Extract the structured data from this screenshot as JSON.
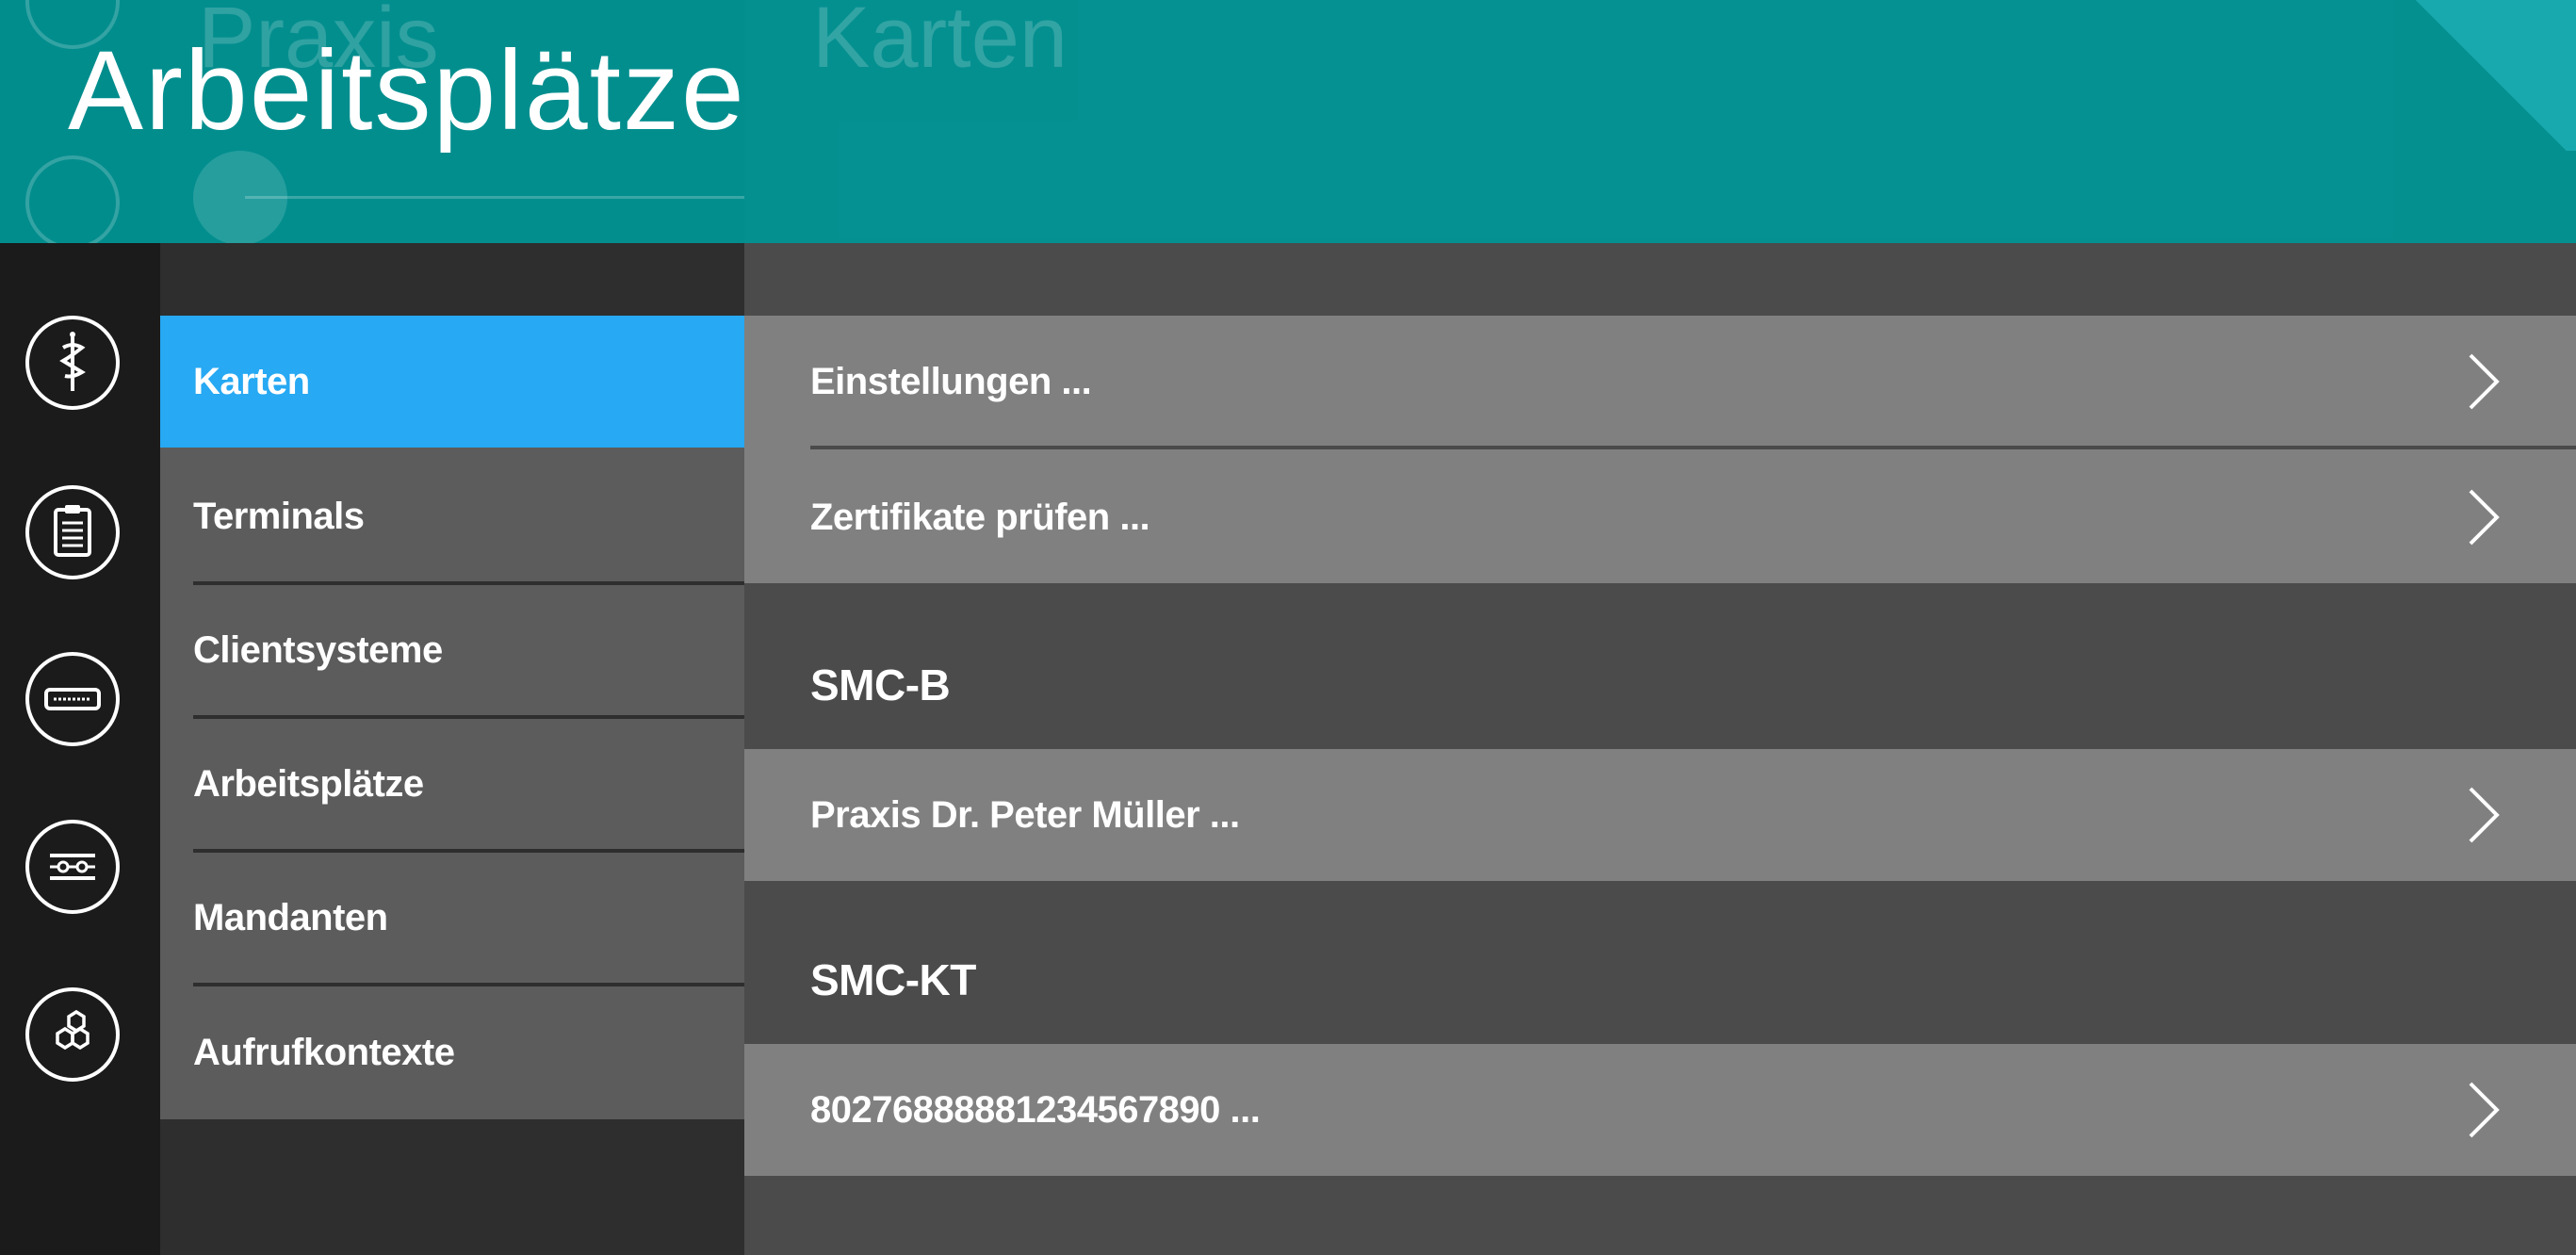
{
  "banner": {
    "title": "Arbeitsplätze",
    "ghost_left": "Praxis",
    "ghost_right": "Karten"
  },
  "rail": {
    "icons": [
      "caduceus-icon",
      "clipboard-icon",
      "terminal-device-icon",
      "settings-sliders-icon",
      "network-nodes-icon"
    ]
  },
  "subnav": {
    "items": [
      {
        "label": "Karten",
        "active": true
      },
      {
        "label": "Terminals",
        "active": false
      },
      {
        "label": "Clientsysteme",
        "active": false
      },
      {
        "label": "Arbeitsplätze",
        "active": false
      },
      {
        "label": "Mandanten",
        "active": false
      },
      {
        "label": "Aufrufkontexte",
        "active": false
      }
    ]
  },
  "main": {
    "settings_label": "Einstellungen ...",
    "check_certs_label": "Zertifikate prüfen ...",
    "smcb": {
      "title": "SMC-B",
      "item": "Praxis Dr. Peter Müller ..."
    },
    "smckt": {
      "title": "SMC-KT",
      "item": "80276888881234567890 ..."
    }
  },
  "colors": {
    "accent": "#27a9f3",
    "banner": "#009696",
    "row": "#808080",
    "panel": "#4b4b4b",
    "rail": "#1b1b1b"
  }
}
